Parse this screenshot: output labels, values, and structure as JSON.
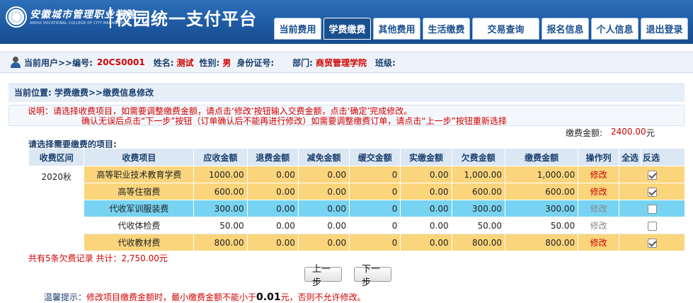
{
  "header": {
    "school_name_cn": "安徽城市管理职业学院",
    "school_name_en": "ANHUI VOCATIONAL COLLEGE OF CITY MANAGEMENT",
    "platform_title": "校园统一支付平台",
    "nav": [
      {
        "label": "当前费用",
        "active": false
      },
      {
        "label": "学费缴费",
        "active": true
      },
      {
        "label": "其他费用",
        "active": false
      },
      {
        "label": "生活缴费",
        "active": false
      },
      {
        "label": "交易查询",
        "active": false
      },
      {
        "label": "报名信息",
        "active": false
      },
      {
        "label": "个人信息",
        "active": false
      },
      {
        "label": "退出登录",
        "active": false
      }
    ]
  },
  "userbar": {
    "current_user_label": "当前用户>>编号:",
    "id": "20CS0001",
    "name_label": "姓名:",
    "name": "测试",
    "gender_label": "性别:",
    "gender": "男",
    "idcard_label": "身份证号:",
    "dept_label": "部门:",
    "dept": "商贸管理学院",
    "class_label": "班级:"
  },
  "breadcrumb": "当前位置: 学费缴费>>缴费信息修改",
  "notice": {
    "line1": "说明：请选择收费项目，如需要调整缴费金额，请点击‘修改’按钮输入交费金额，点击‘确定’完成修改。",
    "line2": "确认无误后点击“下一步”按钮（订单确认后不能再进行修改）如需要调整缴费订单，请点击“上一步”按钮重新选择"
  },
  "payment_amount": {
    "label": "缴费金额:",
    "value": "2400.00",
    "unit": "元"
  },
  "select_title": "请选择需要缴费的项目:",
  "table": {
    "headers": [
      "收费区间",
      "收费项目",
      "应收金额",
      "退费金额",
      "减免金额",
      "缓交金额",
      "实缴金额",
      "欠费金额",
      "缴费金额",
      "操作列",
      "全选",
      "反选"
    ],
    "term": "2020秋",
    "rows": [
      {
        "item": "高等职业技术教育学费",
        "receivable": "1000.00",
        "refund": "0.00",
        "reduce": "0.00",
        "defer": "0",
        "paid": "0.00",
        "owed": "1,000.00",
        "pay": "1,000.00",
        "op": "修改",
        "checked": true,
        "color": "y"
      },
      {
        "item": "高等住宿费",
        "receivable": "600.00",
        "refund": "0.00",
        "reduce": "0.00",
        "defer": "0",
        "paid": "0.00",
        "owed": "600.00",
        "pay": "600.00",
        "op": "修改",
        "checked": true,
        "color": "y"
      },
      {
        "item": "代收军训服装费",
        "receivable": "300.00",
        "refund": "0.00",
        "reduce": "0.00",
        "defer": "0",
        "paid": "0.00",
        "owed": "300.00",
        "pay": "300.00",
        "op": "修改",
        "checked": false,
        "color": "b"
      },
      {
        "item": "代收体检费",
        "receivable": "50.00",
        "refund": "0.00",
        "reduce": "0.00",
        "defer": "0",
        "paid": "0.00",
        "owed": "50.00",
        "pay": "50.00",
        "op": "修改",
        "checked": false,
        "color": "w"
      },
      {
        "item": "代收教材费",
        "receivable": "800.00",
        "refund": "0.00",
        "reduce": "0.00",
        "defer": "0",
        "paid": "0.00",
        "owed": "800.00",
        "pay": "800.00",
        "op": "修改",
        "checked": true,
        "color": "y"
      }
    ]
  },
  "summary": "共有5条欠费记录  共计：2,750.00元",
  "buttons": {
    "prev": "上一步",
    "next": "下一步"
  },
  "tip": {
    "label": "温馨提示：",
    "text1": "修改项目缴费金额时，最小缴费金额不能小于",
    "amount": "0.01",
    "text2": "元，否则不允许修改。"
  }
}
